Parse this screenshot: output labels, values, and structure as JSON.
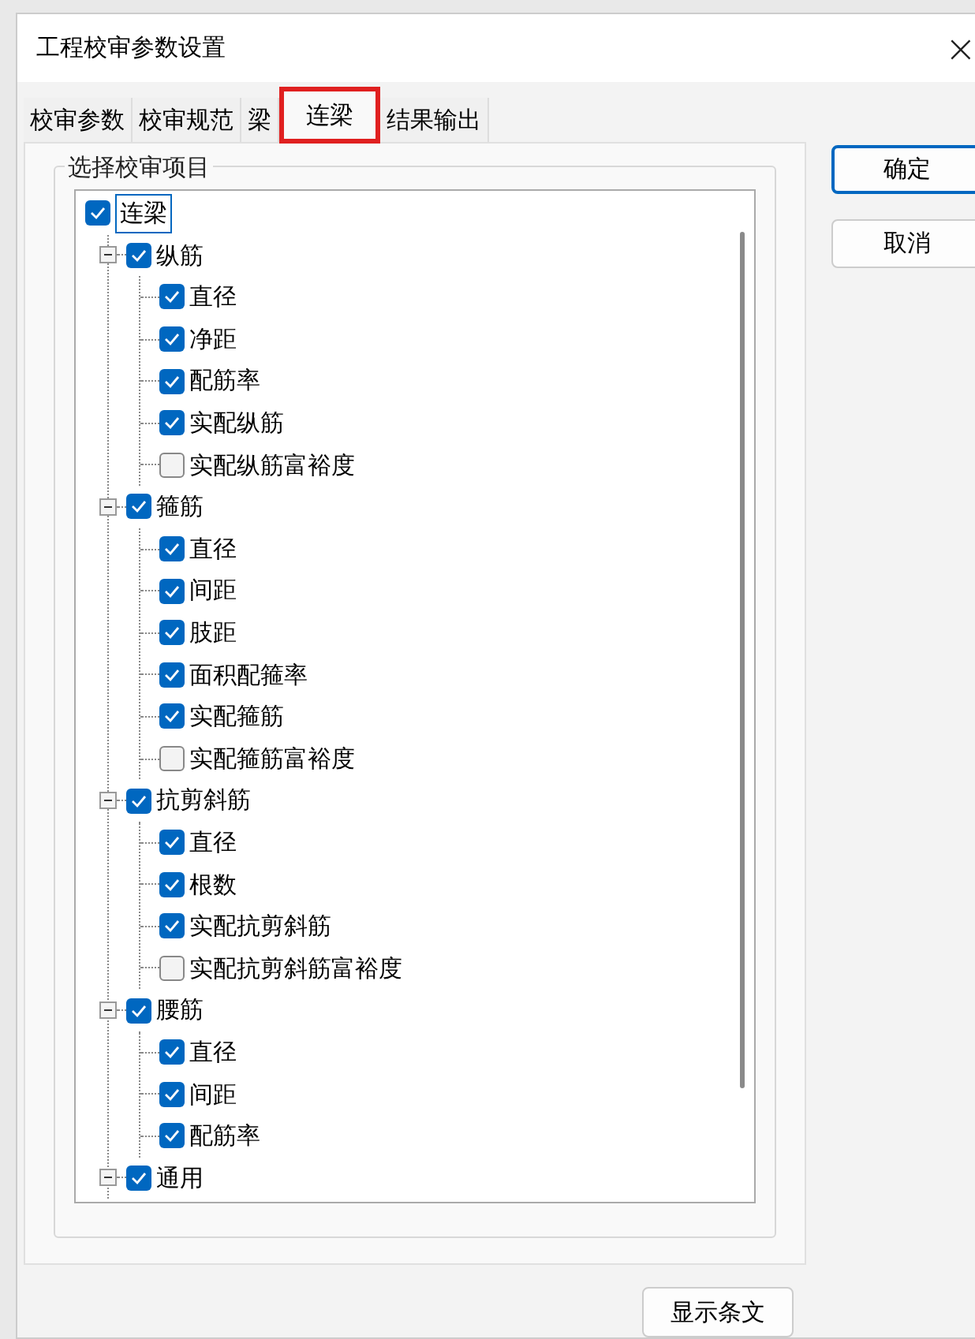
{
  "window": {
    "title": "工程校审参数设置",
    "close": "×"
  },
  "tabs": [
    {
      "label": "校审参数",
      "selected": false,
      "highlighted": false
    },
    {
      "label": "校审规范",
      "selected": false,
      "highlighted": false
    },
    {
      "label": "梁",
      "selected": false,
      "highlighted": false
    },
    {
      "label": "连梁",
      "selected": true,
      "highlighted": true
    },
    {
      "label": "结果输出",
      "selected": false,
      "highlighted": false
    }
  ],
  "group": {
    "title": "选择校审项目"
  },
  "tree": [
    {
      "label": "连梁",
      "checked": true,
      "focused": true,
      "children": [
        {
          "label": "纵筋",
          "checked": true,
          "expanded": true,
          "children": [
            {
              "label": "直径",
              "checked": true
            },
            {
              "label": "净距",
              "checked": true
            },
            {
              "label": "配筋率",
              "checked": true
            },
            {
              "label": "实配纵筋",
              "checked": true
            },
            {
              "label": "实配纵筋富裕度",
              "checked": false
            }
          ]
        },
        {
          "label": "箍筋",
          "checked": true,
          "expanded": true,
          "children": [
            {
              "label": "直径",
              "checked": true
            },
            {
              "label": "间距",
              "checked": true
            },
            {
              "label": "肢距",
              "checked": true
            },
            {
              "label": "面积配箍率",
              "checked": true
            },
            {
              "label": "实配箍筋",
              "checked": true
            },
            {
              "label": "实配箍筋富裕度",
              "checked": false
            }
          ]
        },
        {
          "label": "抗剪斜筋",
          "checked": true,
          "expanded": true,
          "children": [
            {
              "label": "直径",
              "checked": true
            },
            {
              "label": "根数",
              "checked": true
            },
            {
              "label": "实配抗剪斜筋",
              "checked": true
            },
            {
              "label": "实配抗剪斜筋富裕度",
              "checked": false
            }
          ]
        },
        {
          "label": "腰筋",
          "checked": true,
          "expanded": true,
          "children": [
            {
              "label": "直径",
              "checked": true
            },
            {
              "label": "间距",
              "checked": true
            },
            {
              "label": "配筋率",
              "checked": true
            }
          ]
        },
        {
          "label": "通用",
          "checked": true,
          "expanded": true
        }
      ]
    }
  ],
  "buttons": [
    "确定",
    "取消"
  ],
  "show_clauses_button": "显示条文"
}
